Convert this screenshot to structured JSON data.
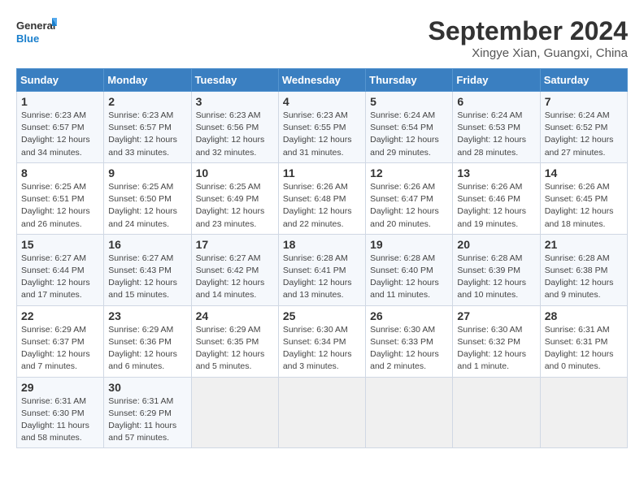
{
  "header": {
    "logo_line1": "General",
    "logo_line2": "Blue",
    "month_title": "September 2024",
    "location": "Xingye Xian, Guangxi, China"
  },
  "weekdays": [
    "Sunday",
    "Monday",
    "Tuesday",
    "Wednesday",
    "Thursday",
    "Friday",
    "Saturday"
  ],
  "weeks": [
    [
      {
        "day": "1",
        "sunrise": "6:23 AM",
        "sunset": "6:57 PM",
        "daylight": "12 hours and 34 minutes."
      },
      {
        "day": "2",
        "sunrise": "6:23 AM",
        "sunset": "6:57 PM",
        "daylight": "12 hours and 33 minutes."
      },
      {
        "day": "3",
        "sunrise": "6:23 AM",
        "sunset": "6:56 PM",
        "daylight": "12 hours and 32 minutes."
      },
      {
        "day": "4",
        "sunrise": "6:23 AM",
        "sunset": "6:55 PM",
        "daylight": "12 hours and 31 minutes."
      },
      {
        "day": "5",
        "sunrise": "6:24 AM",
        "sunset": "6:54 PM",
        "daylight": "12 hours and 29 minutes."
      },
      {
        "day": "6",
        "sunrise": "6:24 AM",
        "sunset": "6:53 PM",
        "daylight": "12 hours and 28 minutes."
      },
      {
        "day": "7",
        "sunrise": "6:24 AM",
        "sunset": "6:52 PM",
        "daylight": "12 hours and 27 minutes."
      }
    ],
    [
      {
        "day": "8",
        "sunrise": "6:25 AM",
        "sunset": "6:51 PM",
        "daylight": "12 hours and 26 minutes."
      },
      {
        "day": "9",
        "sunrise": "6:25 AM",
        "sunset": "6:50 PM",
        "daylight": "12 hours and 24 minutes."
      },
      {
        "day": "10",
        "sunrise": "6:25 AM",
        "sunset": "6:49 PM",
        "daylight": "12 hours and 23 minutes."
      },
      {
        "day": "11",
        "sunrise": "6:26 AM",
        "sunset": "6:48 PM",
        "daylight": "12 hours and 22 minutes."
      },
      {
        "day": "12",
        "sunrise": "6:26 AM",
        "sunset": "6:47 PM",
        "daylight": "12 hours and 20 minutes."
      },
      {
        "day": "13",
        "sunrise": "6:26 AM",
        "sunset": "6:46 PM",
        "daylight": "12 hours and 19 minutes."
      },
      {
        "day": "14",
        "sunrise": "6:26 AM",
        "sunset": "6:45 PM",
        "daylight": "12 hours and 18 minutes."
      }
    ],
    [
      {
        "day": "15",
        "sunrise": "6:27 AM",
        "sunset": "6:44 PM",
        "daylight": "12 hours and 17 minutes."
      },
      {
        "day": "16",
        "sunrise": "6:27 AM",
        "sunset": "6:43 PM",
        "daylight": "12 hours and 15 minutes."
      },
      {
        "day": "17",
        "sunrise": "6:27 AM",
        "sunset": "6:42 PM",
        "daylight": "12 hours and 14 minutes."
      },
      {
        "day": "18",
        "sunrise": "6:28 AM",
        "sunset": "6:41 PM",
        "daylight": "12 hours and 13 minutes."
      },
      {
        "day": "19",
        "sunrise": "6:28 AM",
        "sunset": "6:40 PM",
        "daylight": "12 hours and 11 minutes."
      },
      {
        "day": "20",
        "sunrise": "6:28 AM",
        "sunset": "6:39 PM",
        "daylight": "12 hours and 10 minutes."
      },
      {
        "day": "21",
        "sunrise": "6:28 AM",
        "sunset": "6:38 PM",
        "daylight": "12 hours and 9 minutes."
      }
    ],
    [
      {
        "day": "22",
        "sunrise": "6:29 AM",
        "sunset": "6:37 PM",
        "daylight": "12 hours and 7 minutes."
      },
      {
        "day": "23",
        "sunrise": "6:29 AM",
        "sunset": "6:36 PM",
        "daylight": "12 hours and 6 minutes."
      },
      {
        "day": "24",
        "sunrise": "6:29 AM",
        "sunset": "6:35 PM",
        "daylight": "12 hours and 5 minutes."
      },
      {
        "day": "25",
        "sunrise": "6:30 AM",
        "sunset": "6:34 PM",
        "daylight": "12 hours and 3 minutes."
      },
      {
        "day": "26",
        "sunrise": "6:30 AM",
        "sunset": "6:33 PM",
        "daylight": "12 hours and 2 minutes."
      },
      {
        "day": "27",
        "sunrise": "6:30 AM",
        "sunset": "6:32 PM",
        "daylight": "12 hours and 1 minute."
      },
      {
        "day": "28",
        "sunrise": "6:31 AM",
        "sunset": "6:31 PM",
        "daylight": "12 hours and 0 minutes."
      }
    ],
    [
      {
        "day": "29",
        "sunrise": "6:31 AM",
        "sunset": "6:30 PM",
        "daylight": "11 hours and 58 minutes."
      },
      {
        "day": "30",
        "sunrise": "6:31 AM",
        "sunset": "6:29 PM",
        "daylight": "11 hours and 57 minutes."
      },
      null,
      null,
      null,
      null,
      null
    ]
  ]
}
